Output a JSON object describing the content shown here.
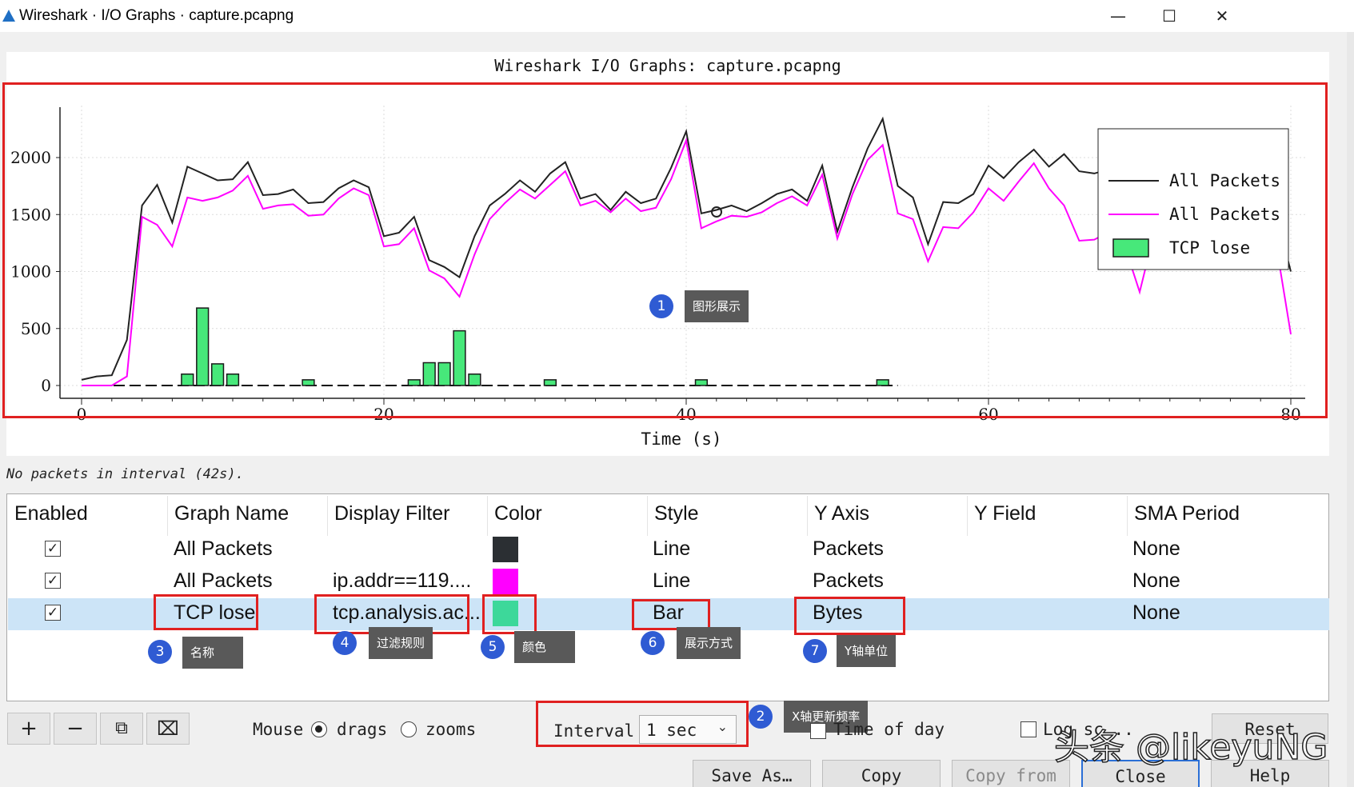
{
  "window": {
    "title": "Wireshark · I/O Graphs · capture.pcapng",
    "minimize": "—",
    "maximize": "☐",
    "close": "✕"
  },
  "chart_title": "Wireshark I/O Graphs: capture.pcapng",
  "status_text": "No packets in interval (42s).",
  "chart_data": {
    "type": "line",
    "title": "Wireshark I/O Graphs: capture.pcapng",
    "xlabel": "Time (s)",
    "ylabel": "",
    "xlim": [
      0,
      80
    ],
    "ylim": [
      0,
      2400
    ],
    "x_ticks": [
      "0",
      "20",
      "40",
      "60",
      "80"
    ],
    "y_ticks": [
      "0",
      "500",
      "1000",
      "1500",
      "2000"
    ],
    "grid": true,
    "legend_position": "top-right",
    "series": [
      {
        "name": "All Packets",
        "style": "line",
        "color": "#222222",
        "x": [
          0,
          1,
          2,
          3,
          4,
          5,
          6,
          7,
          8,
          9,
          10,
          11,
          12,
          13,
          14,
          15,
          16,
          17,
          18,
          19,
          20,
          21,
          22,
          23,
          24,
          25,
          26,
          27,
          28,
          29,
          30,
          31,
          32,
          33,
          34,
          35,
          36,
          37,
          38,
          39,
          40,
          41,
          42,
          43,
          44,
          45,
          46,
          47,
          48,
          49,
          50,
          51,
          52,
          53,
          54,
          55,
          56,
          57,
          58,
          59,
          60,
          61,
          62,
          63,
          64,
          65,
          66,
          67,
          68,
          69,
          70,
          71,
          72,
          73,
          74,
          75,
          76,
          77,
          78,
          79,
          80
        ],
        "y": [
          50,
          80,
          90,
          400,
          1580,
          1760,
          1430,
          1920,
          1860,
          1800,
          1810,
          1960,
          1670,
          1680,
          1720,
          1600,
          1610,
          1730,
          1800,
          1740,
          1310,
          1340,
          1480,
          1100,
          1040,
          950,
          1310,
          1580,
          1680,
          1800,
          1700,
          1860,
          1960,
          1640,
          1680,
          1540,
          1700,
          1600,
          1640,
          1910,
          2230,
          1510,
          1540,
          1580,
          1530,
          1600,
          1680,
          1720,
          1620,
          1930,
          1350,
          1740,
          2080,
          2340,
          1750,
          1650,
          1240,
          1610,
          1600,
          1680,
          1930,
          1820,
          1960,
          2070,
          1920,
          2030,
          1880,
          1860,
          1900,
          1500,
          1140,
          1650,
          1560,
          1620,
          1600,
          1730,
          1650,
          1660,
          1600,
          1520,
          1000
        ]
      },
      {
        "name": "All Packets",
        "style": "line",
        "color": "#ff00ff",
        "x": [
          0,
          1,
          2,
          3,
          4,
          5,
          6,
          7,
          8,
          9,
          10,
          11,
          12,
          13,
          14,
          15,
          16,
          17,
          18,
          19,
          20,
          21,
          22,
          23,
          24,
          25,
          26,
          27,
          28,
          29,
          30,
          31,
          32,
          33,
          34,
          35,
          36,
          37,
          38,
          39,
          40,
          41,
          42,
          43,
          44,
          45,
          46,
          47,
          48,
          49,
          50,
          51,
          52,
          53,
          54,
          55,
          56,
          57,
          58,
          59,
          60,
          61,
          62,
          63,
          64,
          65,
          66,
          67,
          68,
          69,
          70,
          71,
          72,
          73,
          74,
          75,
          76,
          77,
          78,
          79,
          80
        ],
        "y": [
          0,
          0,
          0,
          80,
          1480,
          1410,
          1220,
          1650,
          1620,
          1650,
          1710,
          1840,
          1550,
          1580,
          1590,
          1490,
          1500,
          1640,
          1730,
          1670,
          1220,
          1240,
          1380,
          1010,
          940,
          780,
          1150,
          1460,
          1600,
          1720,
          1640,
          1760,
          1880,
          1580,
          1620,
          1520,
          1640,
          1530,
          1560,
          1810,
          2150,
          1380,
          1440,
          1490,
          1480,
          1520,
          1600,
          1660,
          1580,
          1850,
          1290,
          1680,
          1980,
          2110,
          1510,
          1460,
          1090,
          1390,
          1380,
          1520,
          1730,
          1620,
          1790,
          1950,
          1730,
          1580,
          1270,
          1280,
          1350,
          1230,
          820,
          1360,
          1350,
          1380,
          1340,
          1520,
          1430,
          1440,
          1360,
          1260,
          450
        ]
      },
      {
        "name": "TCP lose",
        "style": "bar",
        "color": "#47e87a",
        "x": [
          7,
          8,
          9,
          10,
          15,
          22,
          23,
          24,
          25,
          26,
          31,
          41,
          53
        ],
        "y": [
          100,
          680,
          190,
          100,
          50,
          50,
          200,
          200,
          480,
          100,
          50,
          50,
          50
        ]
      }
    ]
  },
  "legend": [
    {
      "label": "All Packets",
      "type": "line",
      "color": "#222222"
    },
    {
      "label": "All Packets",
      "type": "line",
      "color": "#ff00ff"
    },
    {
      "label": "TCP lose",
      "type": "bar",
      "color": "#47e87a"
    }
  ],
  "table": {
    "headers": [
      "Enabled",
      "Graph Name",
      "Display Filter",
      "Color",
      "Style",
      "Y Axis",
      "Y Field",
      "SMA Period"
    ],
    "rows": [
      {
        "enabled": "✓",
        "name": "All Packets",
        "filter": "",
        "color": "#2b2f33",
        "style": "Line",
        "y_axis": "Packets",
        "y_field": "",
        "sma": "None"
      },
      {
        "enabled": "✓",
        "name": "All Packets",
        "filter": "ip.addr==119....",
        "color": "#ff00ff",
        "style": "Line",
        "y_axis": "Packets",
        "y_field": "",
        "sma": "None"
      },
      {
        "enabled": "✓",
        "name": "TCP lose",
        "filter": "tcp.analysis.ac...",
        "color": "#3dd89a",
        "style": "Bar",
        "y_axis": "Bytes",
        "y_field": "",
        "sma": "None"
      }
    ]
  },
  "annotations": [
    {
      "num": "1",
      "text": "图形展示"
    },
    {
      "num": "2",
      "text": "X轴更新频率"
    },
    {
      "num": "3",
      "text": "名称"
    },
    {
      "num": "4",
      "text": "过滤规则"
    },
    {
      "num": "5",
      "text": "颜色"
    },
    {
      "num": "6",
      "text": "展示方式"
    },
    {
      "num": "7",
      "text": "Y轴单位"
    }
  ],
  "controls": {
    "mouse_label": "Mouse",
    "drags_label": "drags",
    "zooms_label": "zooms",
    "mouse_mode": "drags",
    "interval_label": "Interval",
    "interval_value": "1 sec",
    "time_of_day_label": "Time of day",
    "log_scale_label": "Log sc...",
    "reset_label": "Reset",
    "add_icon": "+",
    "remove_icon": "−",
    "copy_graph_icon": "⧉",
    "clear_icon": "⌧"
  },
  "buttons": {
    "save_as": "Save As…",
    "copy": "Copy",
    "copy_from": "Copy from",
    "close": "Close",
    "help": "Help"
  },
  "watermark": "头条 @likeyuNG"
}
